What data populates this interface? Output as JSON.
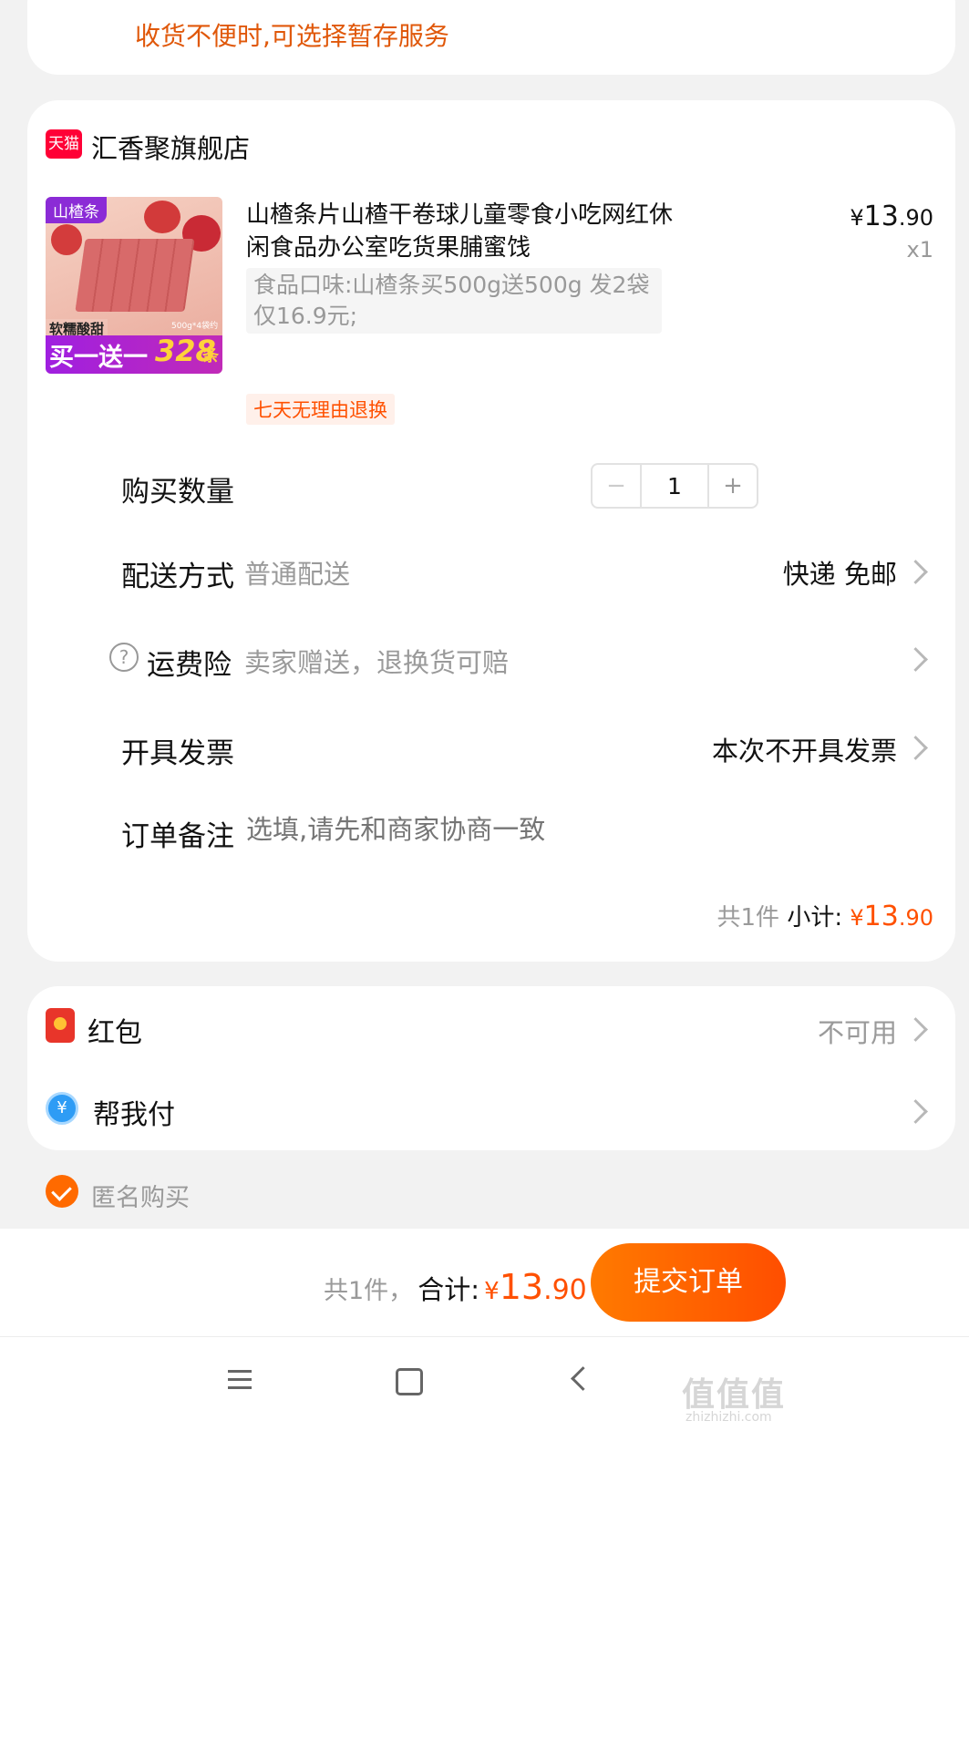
{
  "top_notice": {
    "text": "收货不便时,可选择暂存服务"
  },
  "shop": {
    "badge_text": "天猫",
    "name": "汇香聚旗舰店"
  },
  "product": {
    "image_texts": {
      "top_tag": "山楂条",
      "subtitle": "软糯酸甜",
      "promo": "买一送一",
      "count": "328",
      "count_unit": "条",
      "spec": "500g*4袋约"
    },
    "title": "山楂条片山楂干卷球儿童零食小吃网红休闲食品办公室吃货果脯蜜饯",
    "price_symbol": "¥",
    "price_int": "13",
    "price_dec": ".90",
    "qty_label": "x1",
    "spec": "食品口味:山楂条买500g送500g 发2袋仅16.9元;",
    "return_tag": "七天无理由退换"
  },
  "options": {
    "quantity": {
      "label": "购买数量",
      "value": "1"
    },
    "delivery": {
      "label": "配送方式",
      "sub": "普通配送",
      "value": "快递 免邮"
    },
    "insurance": {
      "label": "运费险",
      "sub": "卖家赠送，退换货可赔"
    },
    "invoice": {
      "label": "开具发票",
      "value": "本次不开具发票"
    },
    "remark": {
      "label": "订单备注",
      "placeholder": "选填,请先和商家协商一致"
    }
  },
  "subtotal": {
    "count_text": "共1件",
    "label": "小计:",
    "symbol": "¥",
    "int": "13",
    "dec": ".90"
  },
  "wallet": {
    "red_packet": {
      "label": "红包",
      "value": "不可用"
    },
    "help_pay": {
      "label": "帮我付"
    }
  },
  "anonymous": {
    "label": "匿名购买"
  },
  "footer": {
    "count_text": "共1件，",
    "total_label": "合计:",
    "symbol": "¥",
    "int": "13",
    "dec": ".90",
    "submit_label": "提交订单"
  },
  "watermark": {
    "main": "值值值",
    "url": "zhizhizhi.com"
  },
  "colors": {
    "accent": "#ff5000",
    "button_start": "#ff7a00",
    "button_end": "#ff4e00"
  }
}
